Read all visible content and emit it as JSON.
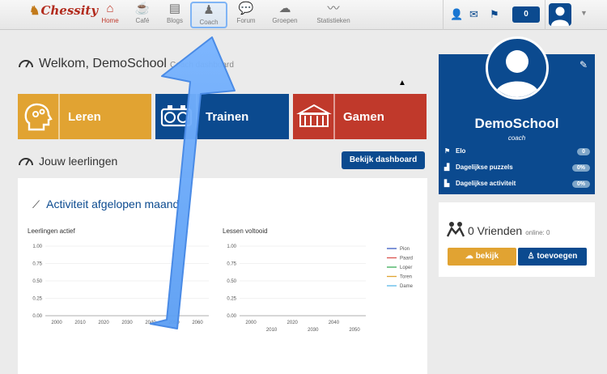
{
  "brand": {
    "logo": "Chessity"
  },
  "nav": {
    "items": [
      {
        "key": "home",
        "label": "Home",
        "icon": "home-icon"
      },
      {
        "key": "cafe",
        "label": "Café",
        "icon": "coffee-icon"
      },
      {
        "key": "blogs",
        "label": "Blogs",
        "icon": "newspaper-icon"
      },
      {
        "key": "coach",
        "label": "Coach",
        "icon": "coach-icon"
      },
      {
        "key": "forum",
        "label": "Forum",
        "icon": "chat-icon"
      },
      {
        "key": "groepen",
        "label": "Groepen",
        "icon": "group-icon"
      },
      {
        "key": "statistieken",
        "label": "Statistieken",
        "icon": "stats-icon"
      }
    ],
    "coins": "0"
  },
  "welcome": {
    "title": "Welkom, DemoSchool",
    "subtitle": "Coach dashboard"
  },
  "tiles": {
    "leren": "Leren",
    "trainen": "Trainen",
    "gamen": "Gamen"
  },
  "students": {
    "title": "Jouw leerlingen",
    "dashboard_button": "Bekijk dashboard"
  },
  "activity": {
    "title": "Activiteit afgelopen maand"
  },
  "chart_data": [
    {
      "type": "line",
      "title": "Leerlingen actief",
      "x_ticks": [
        "2000",
        "2010",
        "2020",
        "2030",
        "2040",
        "2050",
        "2060"
      ],
      "y_ticks": [
        "0.00",
        "0.25",
        "0.50",
        "0.75",
        "1.00"
      ],
      "ylim": [
        0,
        1
      ],
      "series": []
    },
    {
      "type": "line",
      "title": "Lessen voltooid",
      "x_ticks_top": [
        "2000",
        "2020",
        "2040"
      ],
      "x_ticks_bottom": [
        "2010",
        "2030",
        "2050"
      ],
      "y_ticks": [
        "0.00",
        "0.25",
        "0.50",
        "0.75",
        "1.00"
      ],
      "ylim": [
        0,
        1
      ],
      "series": [
        {
          "name": "Pion",
          "color": "#3b5cc4",
          "values": []
        },
        {
          "name": "Paard",
          "color": "#d9534f",
          "values": []
        },
        {
          "name": "Loper",
          "color": "#3cae58",
          "values": []
        },
        {
          "name": "Toren",
          "color": "#e1a332",
          "values": []
        },
        {
          "name": "Dame",
          "color": "#5bb8e8",
          "values": []
        }
      ]
    }
  ],
  "profile": {
    "name": "DemoSchool",
    "role": "coach",
    "stats": [
      {
        "label": "Elo",
        "value": "0"
      },
      {
        "label": "Dagelijkse puzzels",
        "value": "0%"
      },
      {
        "label": "Dagelijkse activiteit",
        "value": "0%"
      }
    ]
  },
  "friends": {
    "count_label": "0 Vrienden",
    "online_label": "online: 0",
    "view_button": "bekijk",
    "add_button": "toevoegen"
  },
  "colors": {
    "primary": "#0b4a8f",
    "orange": "#e1a332",
    "red": "#c0392b"
  }
}
